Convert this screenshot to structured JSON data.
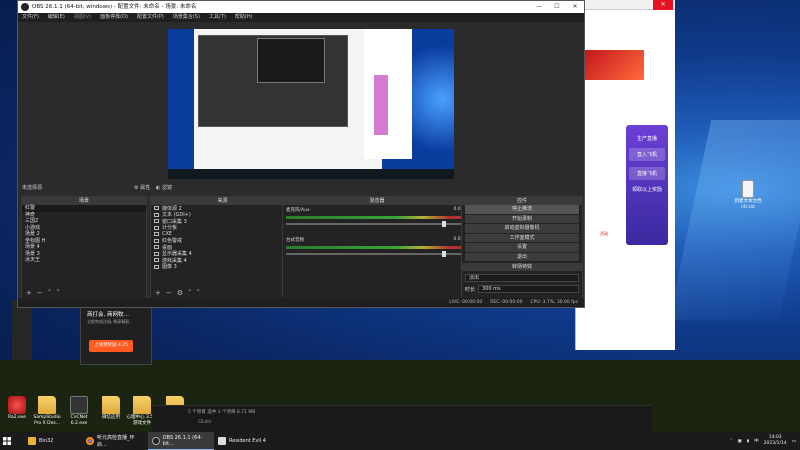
{
  "obs": {
    "title": "OBS 26.1.1 (64-bit, windows) - 配置文件: 未命名 - 场景: 未命名",
    "menu": [
      "文件(F)",
      "编辑(E)",
      "视图(V)",
      "面板停靠(D)",
      "配置文件(P)",
      "场景集合(S)",
      "工具(T)",
      "帮助(H)"
    ],
    "preview_bar": {
      "status": "未选择源",
      "properties": "属性",
      "filters": "滤镜"
    },
    "scenes": {
      "header": "场景",
      "items": [
        "红警",
        "神奇",
        "三国2",
        "小游戏",
        "场景 2",
        "坐标图 H",
        "场景 4",
        "场景 3",
        "冰天王"
      ]
    },
    "sources": {
      "header": "来源",
      "items": [
        "媒体源 2",
        "文本 (GDI+)",
        "窗口采集 3",
        "计分板",
        "CXE",
        "红色警戒",
        "桌面",
        "显示器采集 4",
        "游戏采集 4",
        "图像 3"
      ]
    },
    "mixer": {
      "header": "混音器",
      "channels": [
        {
          "name": "麦克风/Aux",
          "level": "0.0 dB"
        },
        {
          "name": "台式音频",
          "level": "0.0 dB"
        }
      ]
    },
    "controls": {
      "header": "控件",
      "buttons": [
        "停止推流",
        "开始录制",
        "启动虚拟摄像机",
        "工作室模式",
        "设置",
        "退出"
      ]
    },
    "transitions": {
      "header": "转场特效",
      "selected": "淡出",
      "duration_label": "时长",
      "duration": "300 ms"
    },
    "status": {
      "live": "LIVE: 00:00:00",
      "rec": "REC: 00:00:00",
      "cpu": "CPU: 3.7%, 30.00 fps"
    }
  },
  "wechat": {
    "title": "商打会, 商网牧…",
    "subtitle": "立即完成注册, 畅享精彩",
    "button": "上线领奖励 4.25"
  },
  "browser": {
    "promo_title": "生产直播",
    "promo_items": [
      "直入飞机",
      "直接飞机"
    ],
    "promo_footer": "领取以上奖励",
    "notice": "活动"
  },
  "desktop_icons": [
    {
      "label": "Ra2.exe"
    },
    {
      "label": "SampStudio Pro X Des..."
    },
    {
      "label": "CnCNet 6.2.exe"
    },
    {
      "label": "微信应用"
    },
    {
      "label": "心理中心 3.5.2游戏文件"
    },
    {
      "label": "推荐"
    },
    {
      "label": "新建文本文档 (4).txt"
    }
  ],
  "explorer": {
    "status": "5 个项目  选中 1 个项目  8.71 MB",
    "sub": "CEuhit"
  },
  "taskbar": {
    "items": [
      {
        "label": "Bin32"
      },
      {
        "label": "听元高检直播_环启..."
      },
      {
        "label": "OBS 26.1.1 (64-bit..."
      },
      {
        "label": "Resident Evil 4"
      }
    ],
    "time": "14:03",
    "date": "2023/1/14",
    "lang": "中"
  }
}
